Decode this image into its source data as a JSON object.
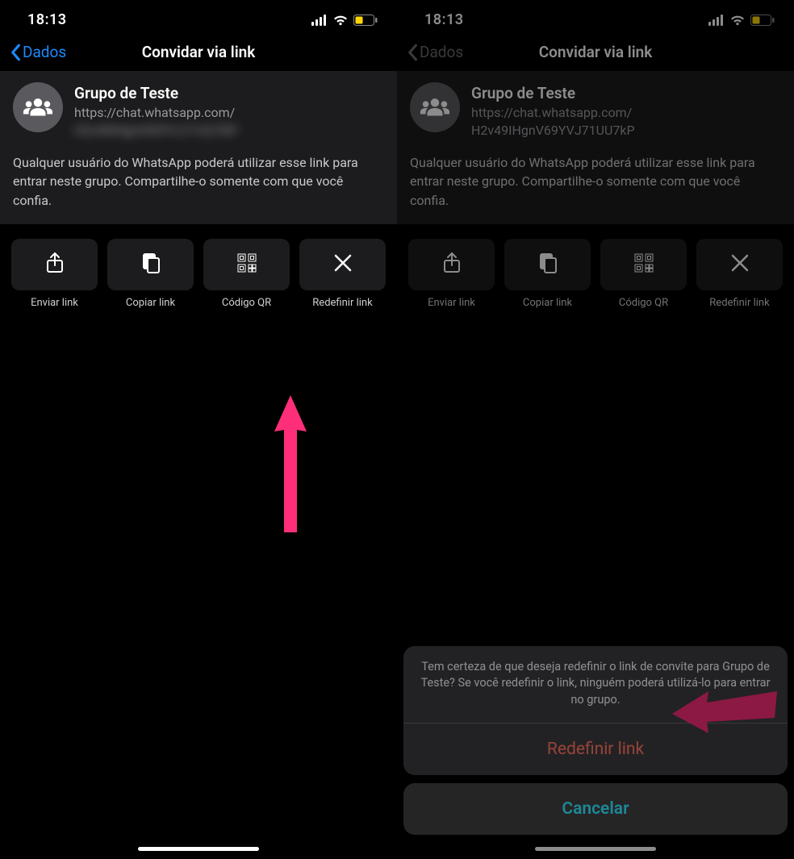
{
  "status": {
    "time": "18:13"
  },
  "nav": {
    "back_label": "Dados",
    "title": "Convidar via link"
  },
  "group": {
    "name": "Grupo de Teste",
    "link_line1": "https://chat.whatsapp.com/",
    "link_line2_blurred": "H2v49IHgnV69YVJ71UU7kP",
    "link_line2_plain": "H2v49IHgnV69YVJ71UU7kP",
    "disclaimer": "Qualquer usuário do WhatsApp poderá utilizar esse link para entrar neste grupo. Compartilhe-o somente com que você confia."
  },
  "actions": {
    "send": "Enviar link",
    "copy": "Copiar link",
    "qr": "Código QR",
    "reset": "Redefinir link"
  },
  "sheet": {
    "message": "Tem certeza de que deseja redefinir o link de convite para Grupo de Teste? Se você redefinir o link, ninguém poderá utilizá-lo para entrar no grupo.",
    "reset": "Redefinir link",
    "cancel": "Cancelar"
  },
  "colors": {
    "ios_blue": "#1e89ff",
    "ios_red": "#ff453a",
    "arrow_pink": "#ff2e79"
  }
}
